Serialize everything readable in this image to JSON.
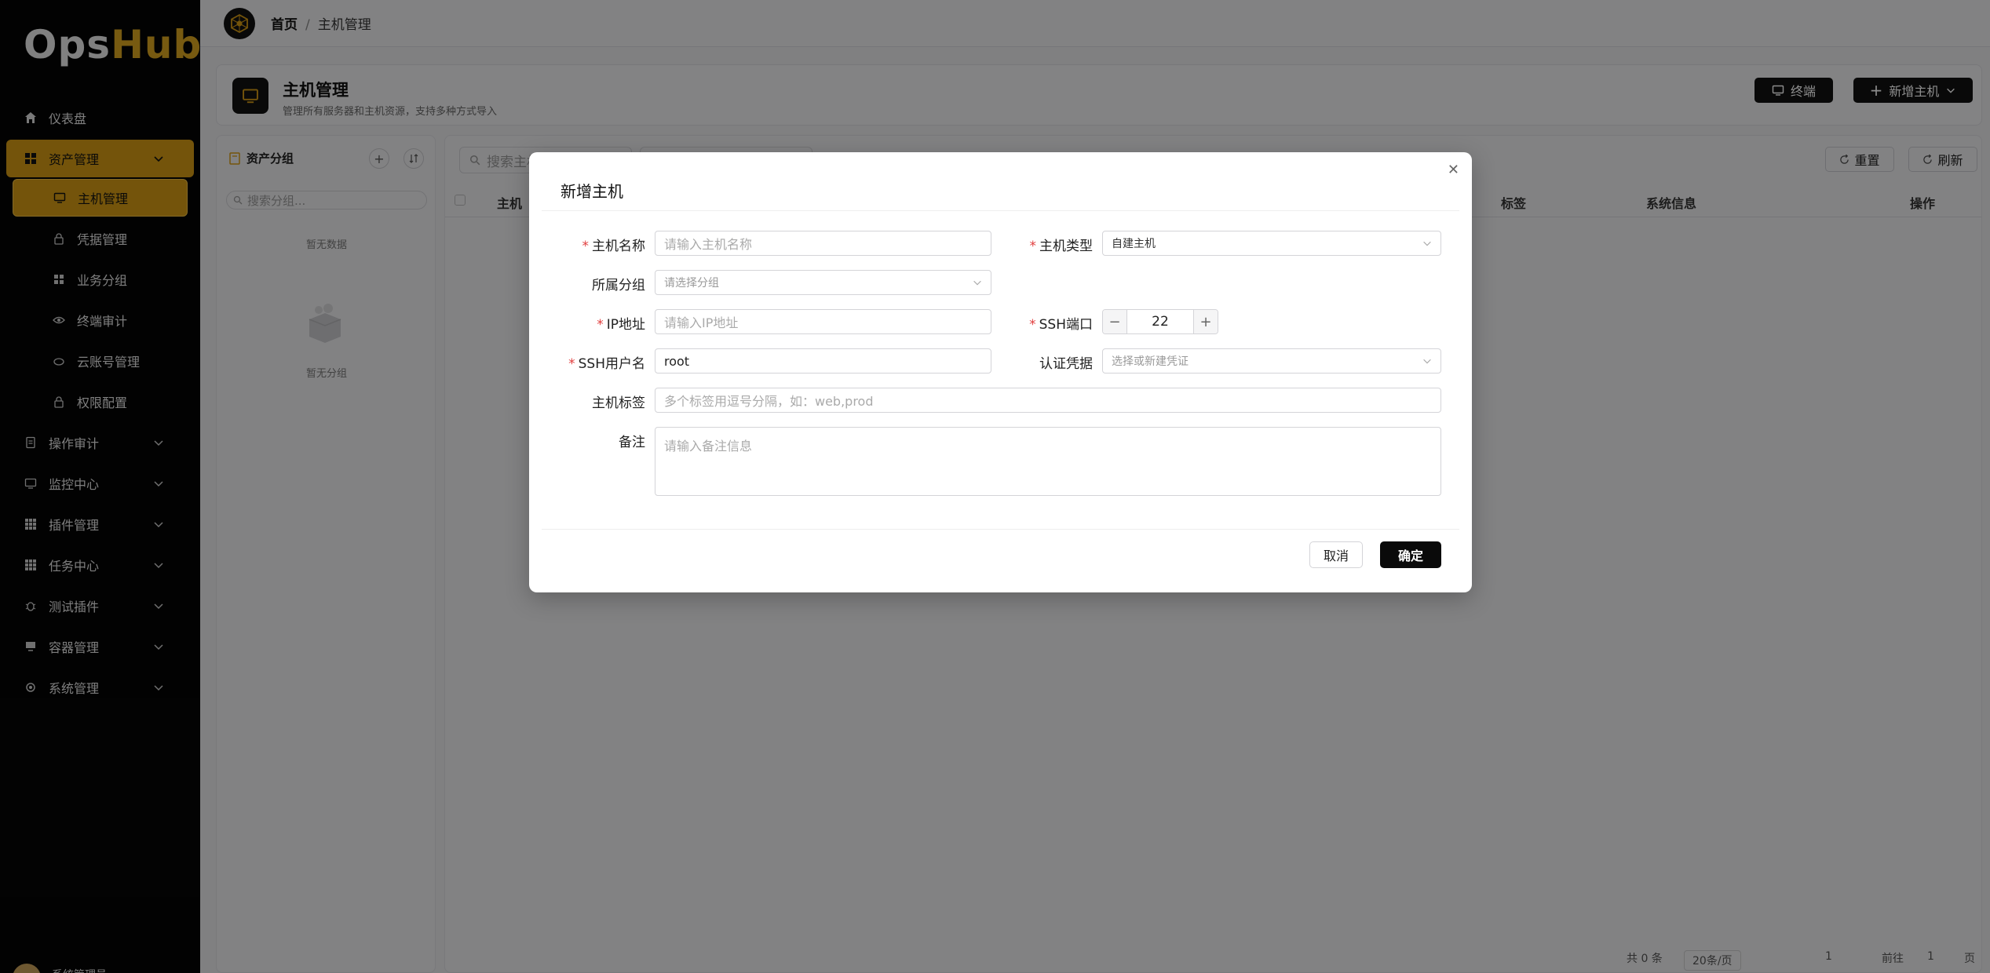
{
  "app": {
    "logo_a": "Ops",
    "logo_b": "Hub"
  },
  "sidebar": {
    "items": [
      {
        "label": "仪表盘"
      },
      {
        "label": "资产管理"
      },
      {
        "label": "主机管理"
      },
      {
        "label": "凭据管理"
      },
      {
        "label": "业务分组"
      },
      {
        "label": "终端审计"
      },
      {
        "label": "云账号管理"
      },
      {
        "label": "权限配置"
      },
      {
        "label": "操作审计"
      },
      {
        "label": "监控中心"
      },
      {
        "label": "插件管理"
      },
      {
        "label": "任务中心"
      },
      {
        "label": "测试插件"
      },
      {
        "label": "容器管理"
      },
      {
        "label": "系统管理"
      }
    ],
    "user": "系统管理员"
  },
  "breadcrumb": {
    "home": "首页",
    "sep": "/",
    "current": "主机管理"
  },
  "header": {
    "title": "主机管理",
    "subtitle": "管理所有服务器和主机资源，支持多种方式导入",
    "terminal_btn": "终端",
    "add_btn": "新增主机"
  },
  "groups": {
    "title": "资产分组",
    "search_placeholder": "搜索分组...",
    "empty_data": "暂无数据",
    "empty_group": "暂无分组"
  },
  "table": {
    "search_placeholder": "搜索主机",
    "reset_btn": "重置",
    "refresh_btn": "刷新",
    "columns": {
      "host": "主机",
      "tags": "标签",
      "sysinfo": "系统信息",
      "ops": "操作"
    },
    "footer_total": "共 0 条",
    "footer_pagesize": "20条/页",
    "footer_page": "1",
    "footer_goto": "前往",
    "footer_goto_val": "1",
    "footer_page_unit": "页"
  },
  "modal": {
    "title": "新增主机",
    "fields": {
      "name_label": "主机名称",
      "name_placeholder": "请输入主机名称",
      "type_label": "主机类型",
      "type_value": "自建主机",
      "group_label": "所属分组",
      "group_placeholder": "请选择分组",
      "ip_label": "IP地址",
      "ip_placeholder": "请输入IP地址",
      "port_label": "SSH端口",
      "port_value": "22",
      "user_label": "SSH用户名",
      "user_value": "root",
      "cred_label": "认证凭据",
      "cred_placeholder": "选择或新建凭证",
      "tags_label": "主机标签",
      "tags_placeholder": "多个标签用逗号分隔，如：web,prod",
      "remark_label": "备注",
      "remark_placeholder": "请输入备注信息"
    },
    "cancel": "取消",
    "confirm": "确定"
  },
  "colors": {
    "accent": "#d39a14",
    "dark": "#111111",
    "required": "#e13d3d"
  },
  "icons": [
    "home-icon",
    "grid-icon",
    "monitor-icon",
    "lock-icon",
    "eye-icon",
    "cloud-icon",
    "doc-icon",
    "apps-icon",
    "bug-icon",
    "server-icon",
    "gear-icon",
    "chevron-down-icon",
    "plus-icon",
    "sort-icon",
    "search-icon",
    "refresh-icon",
    "close-icon",
    "folder-icon"
  ]
}
